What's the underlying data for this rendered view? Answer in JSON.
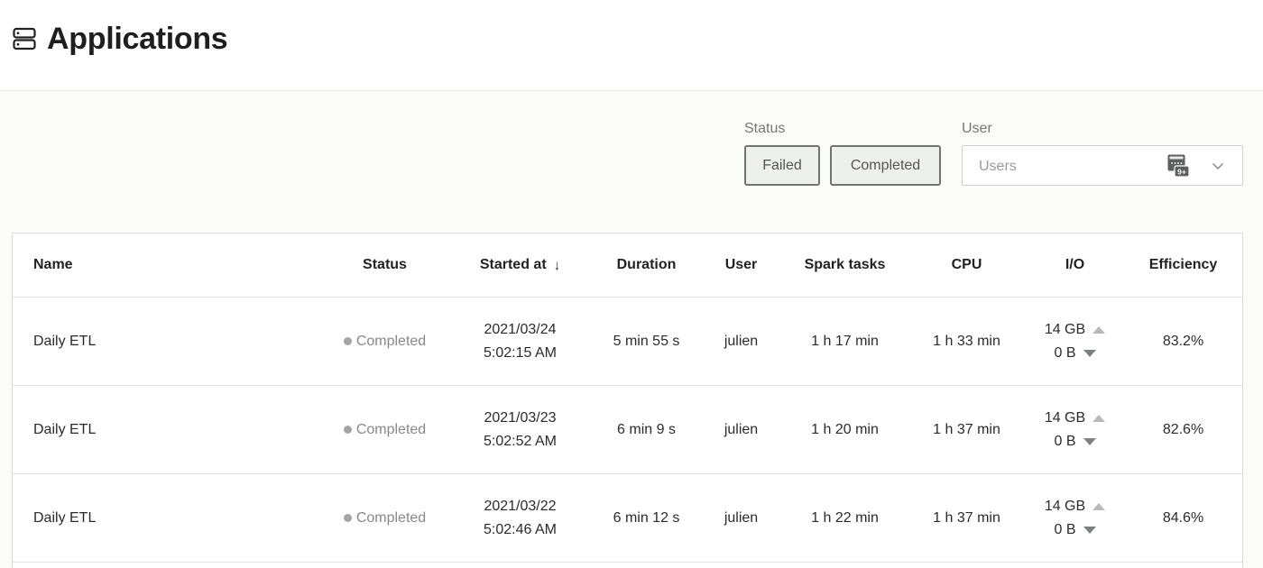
{
  "header": {
    "title": "Applications",
    "icon": "server-stack-icon"
  },
  "filters": {
    "status_label": "Status",
    "status_options": [
      "Failed",
      "Completed"
    ],
    "user_label": "User",
    "user_placeholder": "Users",
    "user_badge": "9+"
  },
  "table": {
    "columns": [
      "Name",
      "Status",
      "Started at",
      "Duration",
      "User",
      "Spark tasks",
      "CPU",
      "I/O",
      "Efficiency"
    ],
    "sort_indicator": "↓",
    "rows": [
      {
        "name": "Daily ETL",
        "status": "Completed",
        "date": "2021/03/24",
        "time": "5:02:15 AM",
        "duration": "5 min 55 s",
        "user": "julien",
        "spark_tasks": "1 h 17 min",
        "cpu": "1 h 33 min",
        "io_in": "14 GB",
        "io_out": "0 B",
        "efficiency": "83.2%"
      },
      {
        "name": "Daily ETL",
        "status": "Completed",
        "date": "2021/03/23",
        "time": "5:02:52 AM",
        "duration": "6 min 9 s",
        "user": "julien",
        "spark_tasks": "1 h 20 min",
        "cpu": "1 h 37 min",
        "io_in": "14 GB",
        "io_out": "0 B",
        "efficiency": "82.6%"
      },
      {
        "name": "Daily ETL",
        "status": "Completed",
        "date": "2021/03/22",
        "time": "5:02:46 AM",
        "duration": "6 min 12 s",
        "user": "julien",
        "spark_tasks": "1 h 22 min",
        "cpu": "1 h 37 min",
        "io_in": "14 GB",
        "io_out": "0 B",
        "efficiency": "84.6%"
      }
    ]
  },
  "colors": {
    "status_completed_dot": "#a2a5a3",
    "button_border": "#6f7371",
    "button_bg": "#eef0ed"
  }
}
